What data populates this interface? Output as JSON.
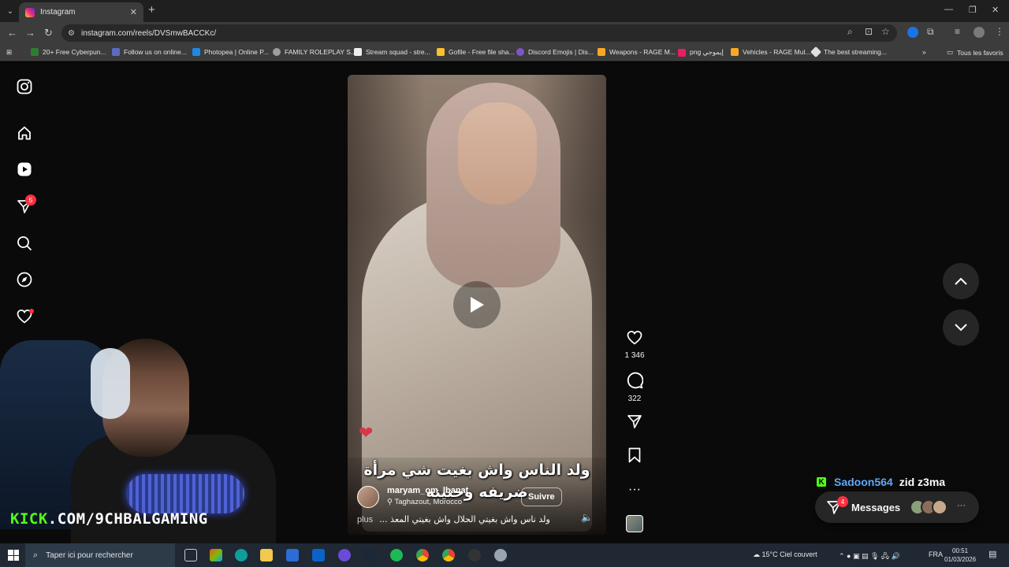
{
  "browser": {
    "tab_title": "Instagram",
    "url": "instagram.com/reels/DVSmwBACCKc/",
    "bookmarks": [
      {
        "label": "20+ Free Cyberpun...",
        "color": "#2e7d32"
      },
      {
        "label": "Follow us on online...",
        "color": "#5c6bc0"
      },
      {
        "label": "Photopea | Online P...",
        "color": "#1e88e5"
      },
      {
        "label": "FAMILY ROLEPLAY S...",
        "color": "#9e9e9e"
      },
      {
        "label": "Stream squad - stre...",
        "color": "#eeeeee"
      },
      {
        "label": "Gofile - Free file sha...",
        "color": "#fbc02d"
      },
      {
        "label": "Discord Emojis | Dis...",
        "color": "#7e57c2"
      },
      {
        "label": "Weapons - RAGE M...",
        "color": "#f9a825"
      },
      {
        "label": "png إيموجي",
        "color": "#e91e63"
      },
      {
        "label": "Vehicles - RAGE Mul...",
        "color": "#f9a825"
      },
      {
        "label": "The best streaming...",
        "color": "#e0e0e0"
      }
    ],
    "all_bookmarks": "Tous les favoris"
  },
  "sidebar": {
    "notification_count": "5"
  },
  "reel": {
    "caption_overlay": "ولد الناس واش بغيت شي مرأة ضريفه وحنينه",
    "username": "maryam_om_lbanat",
    "location": "Taghazout, Morocco",
    "follow_label": "Suivre",
    "more_label": "plus",
    "description": "ولد ناس واش بغيتي الحلال واش بغيتي المعذ ...",
    "likes": "1 346",
    "comments": "322"
  },
  "overlay": {
    "kick_prefix": "KICK",
    "kick_rest": ".COM/9CHBALGAMING",
    "chat_user": "Sadoon564",
    "chat_text": "zid z3ma"
  },
  "messages": {
    "label": "Messages",
    "badge": "4"
  },
  "taskbar": {
    "search_placeholder": "Taper ici pour rechercher",
    "weather": "15°C  Ciel couvert",
    "lang": "FRA",
    "time": "00:51",
    "date": "01/03/2026"
  }
}
